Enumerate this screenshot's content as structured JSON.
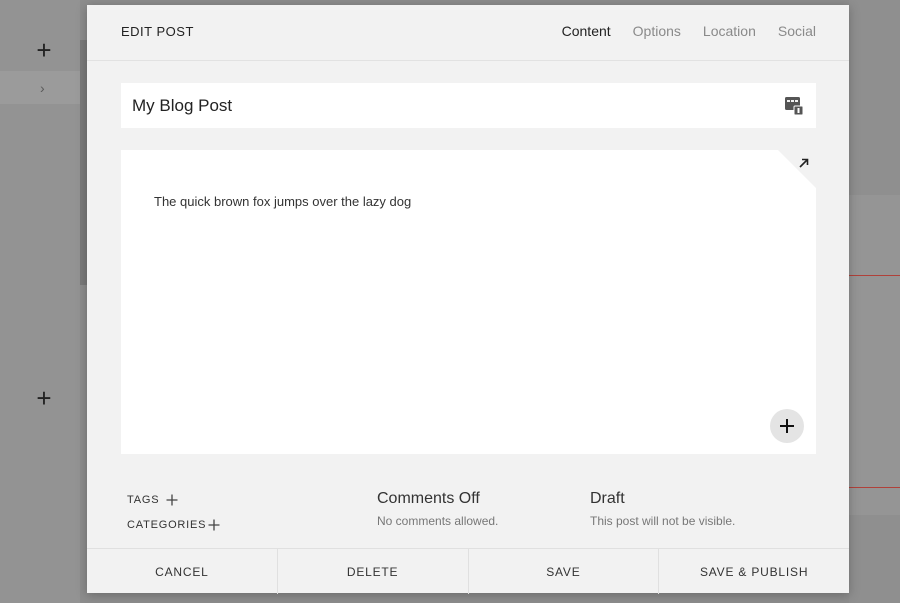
{
  "background": {
    "plus_glyph": "+",
    "chevron_glyph": "›",
    "accent_line_color": "#b0413a"
  },
  "modal": {
    "title": "EDIT POST",
    "tabs": [
      {
        "label": "Content",
        "active": true
      },
      {
        "label": "Options",
        "active": false
      },
      {
        "label": "Location",
        "active": false
      },
      {
        "label": "Social",
        "active": false
      }
    ],
    "post_title": "My Blog Post",
    "thumbnail_icon": "thumbnail-image-icon",
    "editor": {
      "body_text": "The quick brown fox jumps over the lazy dog",
      "expand_icon": "expand-arrow-icon",
      "add_block_icon": "plus-icon"
    },
    "meta": {
      "tags_label": "TAGS",
      "categories_label": "CATEGORIES",
      "comments_status": "Comments Off",
      "comments_sub": "No comments allowed.",
      "post_status": "Draft",
      "post_status_sub": "This post will not be visible."
    },
    "footer": {
      "cancel": "CANCEL",
      "delete": "DELETE",
      "save": "SAVE",
      "save_publish": "SAVE & PUBLISH"
    }
  }
}
